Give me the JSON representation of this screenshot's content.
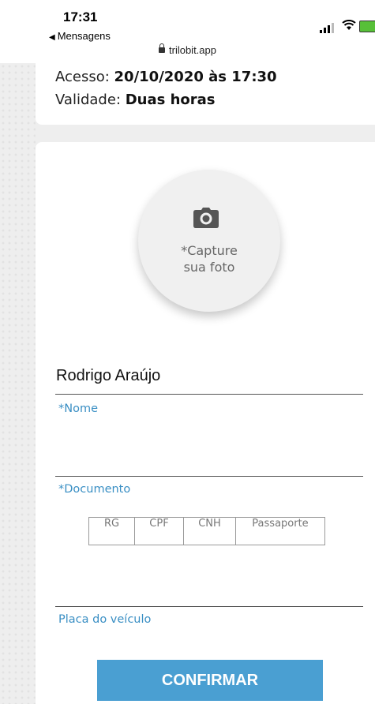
{
  "status_bar": {
    "time": "17:31",
    "back_label": "Mensagens",
    "url": "trilobit.app"
  },
  "access": {
    "access_label": "Acesso: ",
    "access_value": "20/10/2020 às 17:30",
    "validity_label": "Validade: ",
    "validity_value": "Duas horas"
  },
  "photo": {
    "label": "*Capture\nsua foto",
    "icon": "camera-icon"
  },
  "form": {
    "name_value": "Rodrigo Araújo",
    "name_label": "*Nome",
    "document_value": "",
    "document_label": "*Documento",
    "doc_types": [
      "RG",
      "CPF",
      "CNH",
      "Passaporte"
    ],
    "plate_value": "",
    "plate_label": "Placa do veículo",
    "confirm_button": "CONFIRMAR"
  },
  "colors": {
    "accent": "#4a9fd2",
    "label": "#3a8fc4",
    "background": "#eeeeee"
  }
}
